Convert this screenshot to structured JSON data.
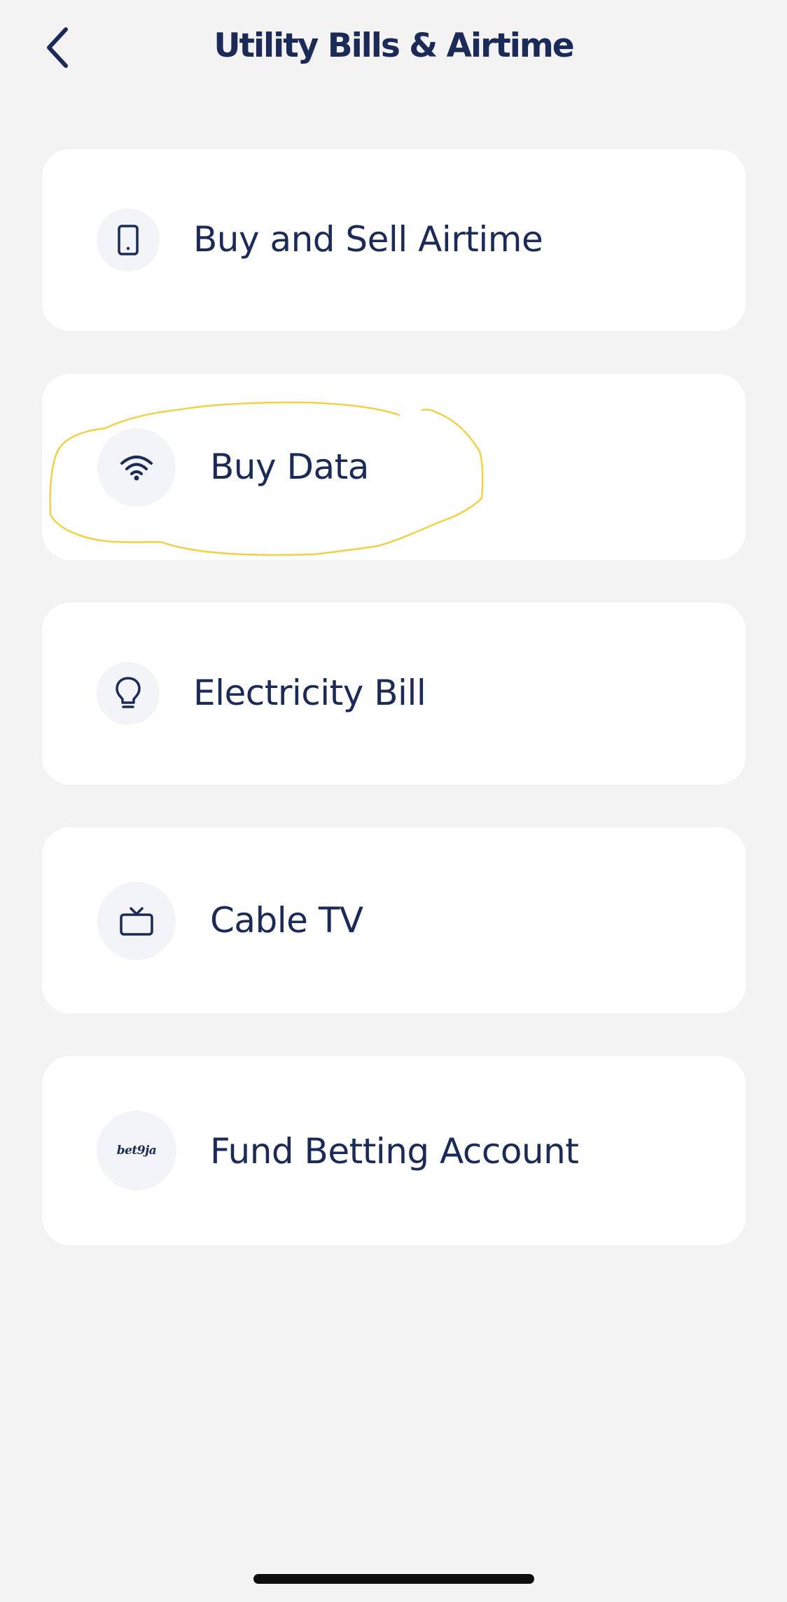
{
  "header": {
    "title": "Utility Bills & Airtime",
    "back_icon": "chevron-left-icon"
  },
  "services": [
    {
      "label": "Buy and Sell Airtime",
      "icon": "smartphone-icon"
    },
    {
      "label": "Buy Data",
      "icon": "wifi-icon"
    },
    {
      "label": "Electricity Bill",
      "icon": "lightbulb-icon"
    },
    {
      "label": "Cable TV",
      "icon": "tv-icon"
    },
    {
      "label": "Fund Betting Account",
      "icon": "bet9ja-logo",
      "logo_text": "bet9ja"
    }
  ],
  "colors": {
    "background": "#f3f3f4",
    "card": "#ffffff",
    "text": "#1b2a56",
    "icon_bg": "#f3f4f7",
    "annotation": "#f2d049"
  }
}
